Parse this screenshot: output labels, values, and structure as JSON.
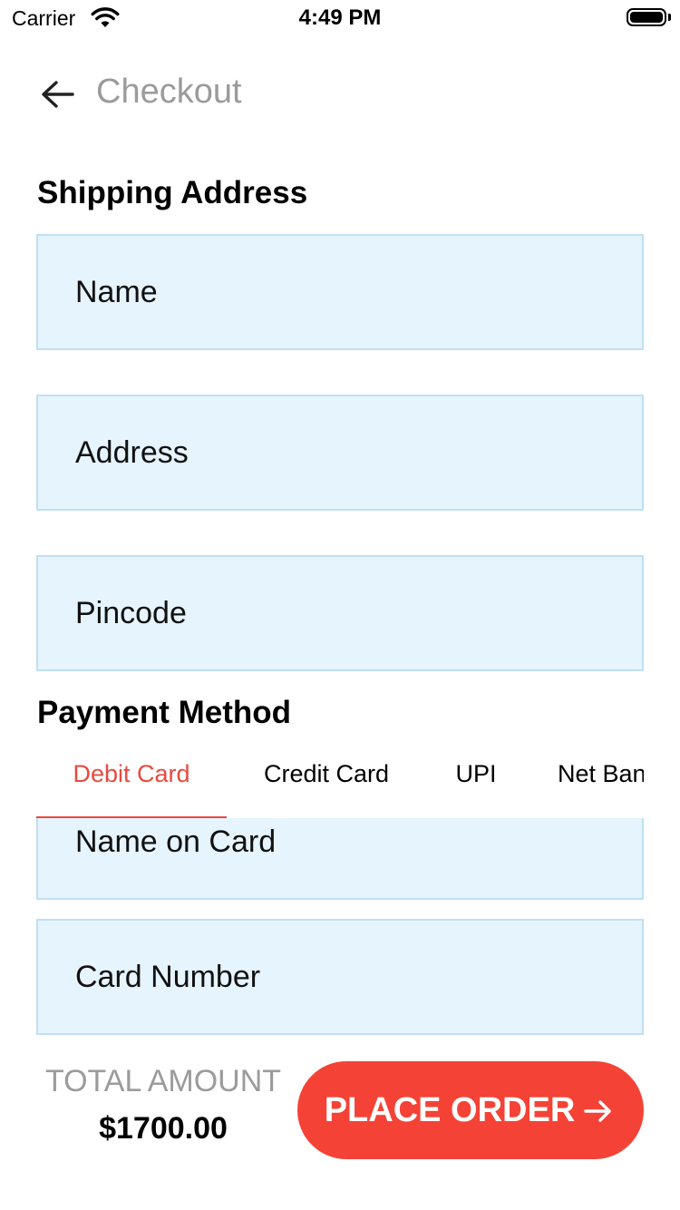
{
  "status_bar": {
    "carrier": "Carrier",
    "time": "4:49 PM"
  },
  "header": {
    "title": "Checkout",
    "back_icon": "arrow-left-icon"
  },
  "shipping": {
    "title": "Shipping Address",
    "fields": {
      "name_placeholder": "Name",
      "address_placeholder": "Address",
      "pincode_placeholder": "Pincode"
    }
  },
  "payment": {
    "title": "Payment Method",
    "tabs": [
      {
        "label": "Debit Card",
        "active": true
      },
      {
        "label": "Credit Card",
        "active": false
      },
      {
        "label": "UPI",
        "active": false
      },
      {
        "label": "Net Banking",
        "active": false
      }
    ],
    "card_fields": {
      "name_on_card_placeholder": "Name on Card",
      "card_number_placeholder": "Card Number"
    }
  },
  "footer": {
    "total_label": "TOTAL AMOUNT",
    "total_value": "$1700.00",
    "place_order_label": "PLACE ORDER"
  },
  "colors": {
    "accent": "#f44336",
    "tab_active": "#e84a3f",
    "field_bg": "#e6f4fe",
    "field_border": "#bfe0f6",
    "muted_text": "#9b9b9b"
  }
}
